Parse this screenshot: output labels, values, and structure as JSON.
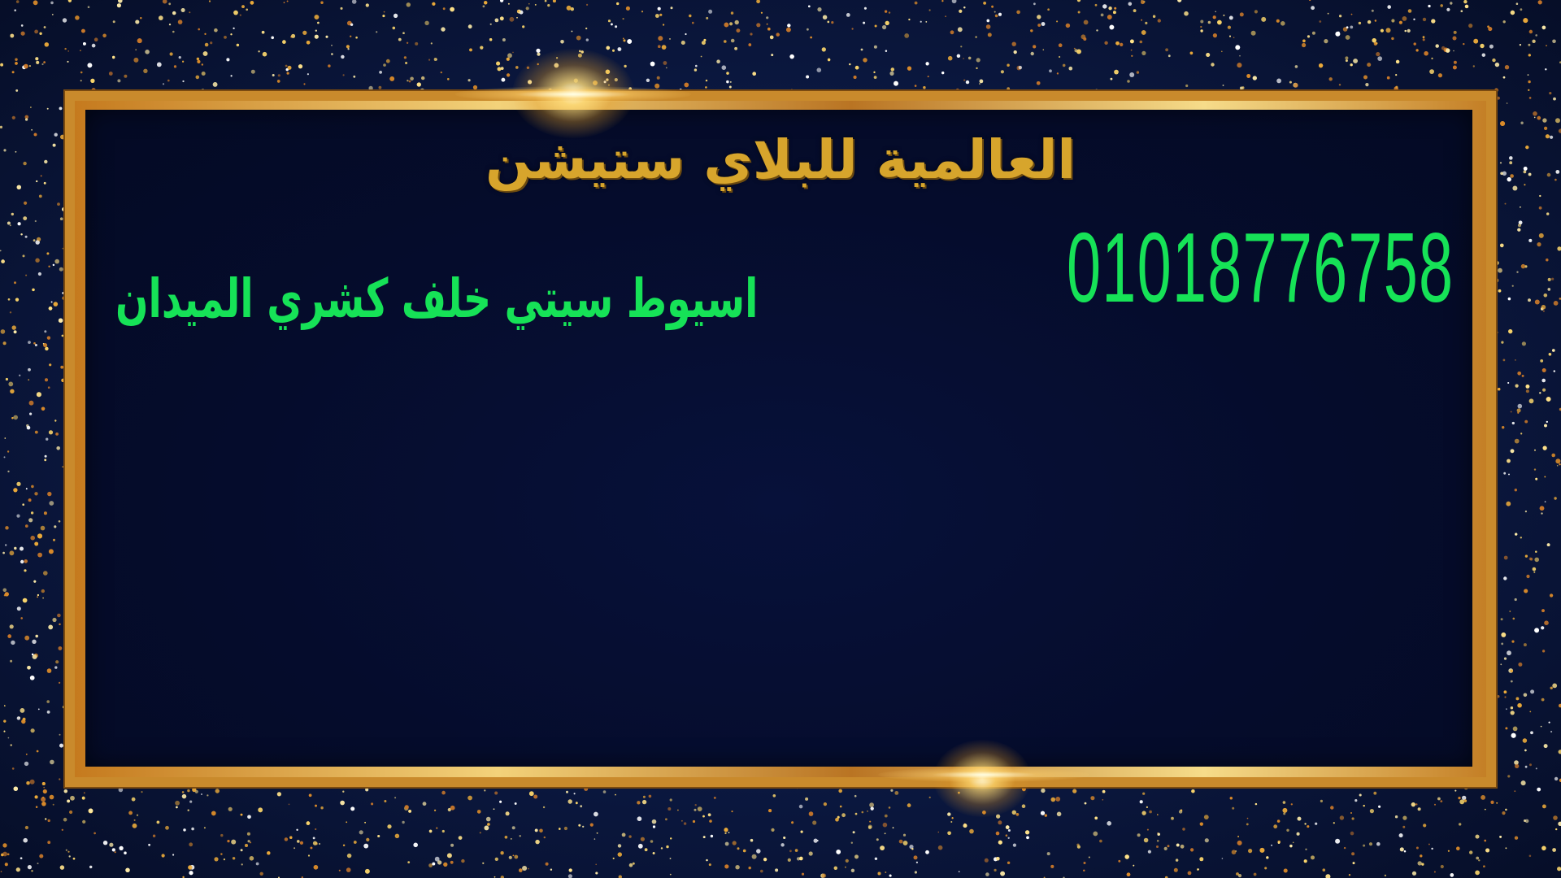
{
  "business_name": "العالمية للبلاي ستيشن",
  "phone": "01018776758",
  "address": "اسيوط سيتي خلف كشري الميدان",
  "colors": {
    "background": "#0a1535",
    "panel": "#050c2c",
    "frame_gold": "#d9a441",
    "title_gold": "#d7a52c",
    "text_green": "#16e257"
  }
}
